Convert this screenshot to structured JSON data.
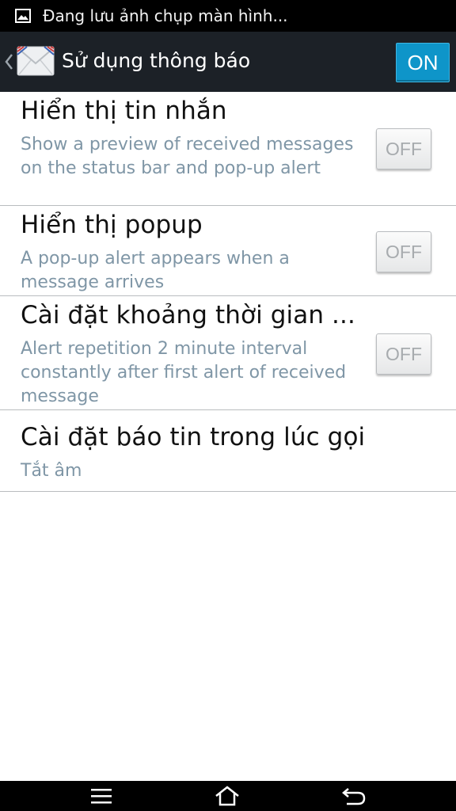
{
  "status_bar": {
    "notification_text": "Đang lưu ảnh chụp màn hình...",
    "icon": "image-icon"
  },
  "action_bar": {
    "back_icon": "chevron-left-icon",
    "app_icon": "envelope-icon",
    "title": "Sử dụng thông báo",
    "master_switch_label": "ON"
  },
  "settings": [
    {
      "title": "Hiển thị tin nhắn",
      "summary": "Show a preview of received messages on the status bar and pop-up alert",
      "toggle": "OFF"
    },
    {
      "title": "Hiển thị popup",
      "summary": "A pop-up alert appears when a message arrives",
      "toggle": "OFF"
    },
    {
      "title": "Cài đặt khoảng thời gian ...",
      "summary": "Alert repetition 2 minute interval constantly after first alert of received message",
      "toggle": "OFF"
    },
    {
      "title": "Cài đặt báo tin trong lúc gọi",
      "summary": "Tắt âm"
    }
  ],
  "nav_bar": {
    "menu_icon": "menu-icon",
    "home_icon": "home-icon",
    "back_icon": "back-arrow-icon"
  },
  "colors": {
    "accent": "#0e95c9",
    "action_bar": "#1c2127",
    "summary_text": "#7f96a6"
  }
}
